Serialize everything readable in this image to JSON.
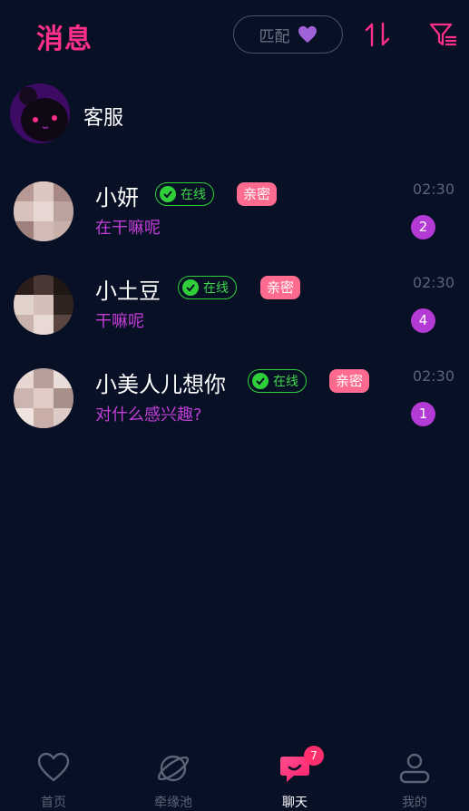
{
  "header": {
    "title": "消息",
    "match_label": "匹配",
    "sort_icon": "sort-arrows-icon",
    "filter_icon": "filter-icon"
  },
  "service": {
    "name": "客服"
  },
  "conversations": [
    {
      "name": "小妍",
      "online": "在线",
      "tag": "亲密",
      "message": "在干嘛呢",
      "time": "02:30",
      "unread": "2"
    },
    {
      "name": "小土豆",
      "online": "在线",
      "tag": "亲密",
      "message": "干嘛呢",
      "time": "02:30",
      "unread": "4"
    },
    {
      "name": "小美人儿想你",
      "online": "在线",
      "tag": "亲密",
      "message": "对什么感兴趣?",
      "time": "02:30",
      "unread": "1"
    }
  ],
  "tabs": [
    {
      "label": "首页",
      "icon": "heart-icon"
    },
    {
      "label": "牵缘池",
      "icon": "planet-icon"
    },
    {
      "label": "聊天",
      "icon": "chat-bubble-icon",
      "badge": "7"
    },
    {
      "label": "我的",
      "icon": "profile-icon"
    }
  ],
  "colors": {
    "accent": "#ff2f8a",
    "unread": "#b33ad4",
    "online": "#2fcf3a",
    "intimate": "#ff6b8e",
    "background": "#081026"
  }
}
